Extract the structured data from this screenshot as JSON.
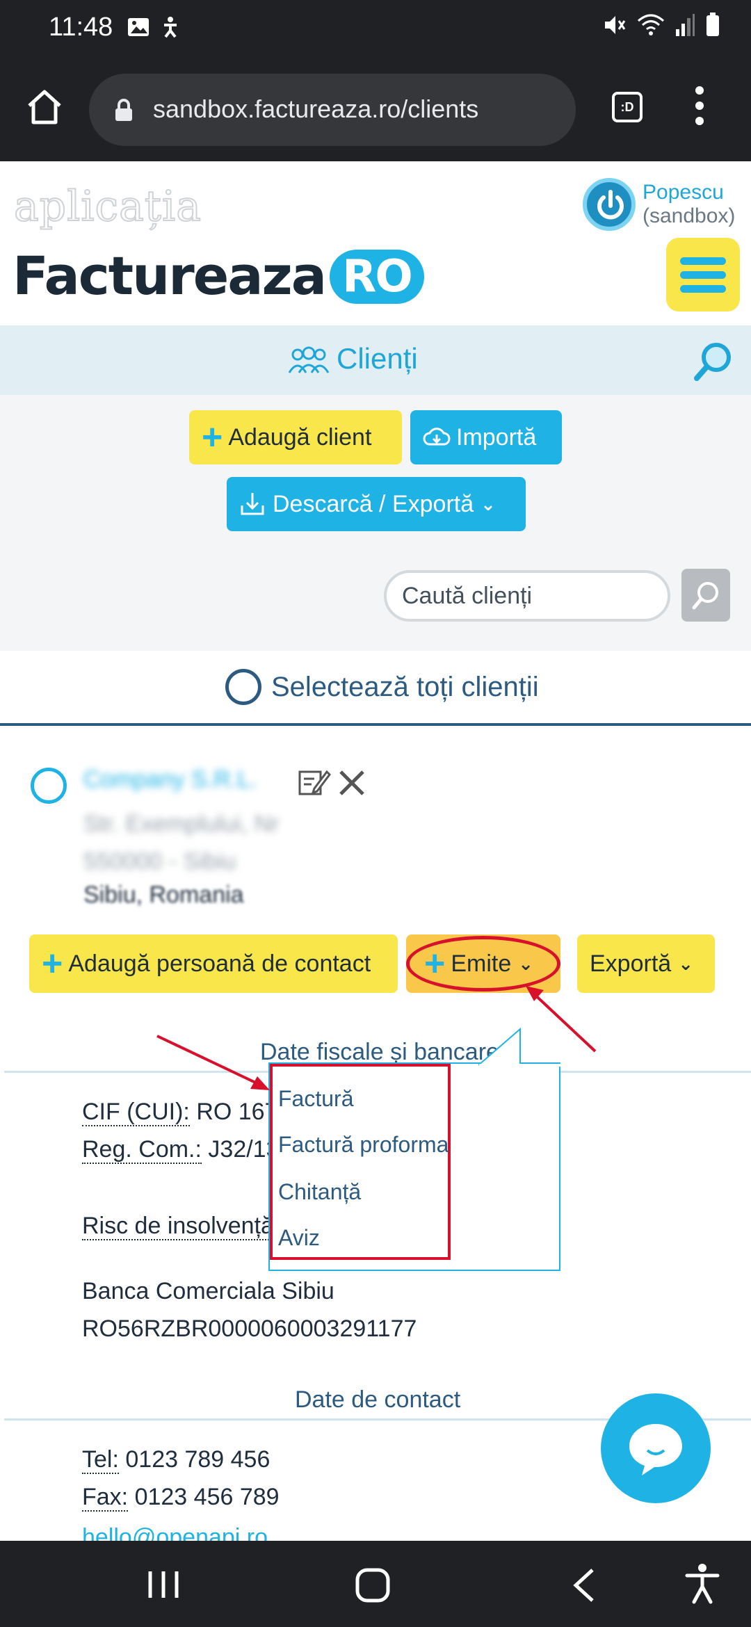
{
  "status_bar": {
    "time": "11:48"
  },
  "browser": {
    "url": "sandbox.factureaza.ro/clients",
    "tabs_badge": ":D"
  },
  "header": {
    "app_tagline": "aplicația",
    "logo_text": "Factureaza",
    "logo_badge": "RO",
    "user_name": "Popescu",
    "user_env": "(sandbox)"
  },
  "section": {
    "title": "Clienți"
  },
  "toolbar": {
    "add_client": "Adaugă client",
    "import": "Importă",
    "download_export": "Descarcă / Exportă",
    "search_placeholder": "Caută clienți"
  },
  "select_all_label": "Selectează toți clienții",
  "client": {
    "name": "Company S.R.L.",
    "street": "Str. Exemplului, Nr",
    "postal": "550000 - Sibiu",
    "city": "Sibiu, Romania",
    "actions": {
      "add_contact": "Adaugă persoană de contact",
      "emite": "Emite",
      "export": "Exportă"
    },
    "fiscal_header": "Date fiscale și bancare",
    "cif_label": "CIF (CUI):",
    "cif_value": "RO 1675",
    "reg_label": "Reg. Com.:",
    "reg_value": "J32/13",
    "insolvency_label": "Risc de insolvență",
    "bank_name": "Banca Comerciala Sibiu",
    "iban": "RO56RZBR0000060003291177",
    "contact_header": "Date de contact",
    "tel_label": "Tel:",
    "tel_value": "0123 789 456",
    "fax_label": "Fax:",
    "fax_value": "0123 456 789",
    "email": "hello@openapi.ro"
  },
  "emite_menu": [
    "Factură",
    "Factură proforma",
    "Chitanță",
    "Aviz"
  ],
  "colors": {
    "accent_blue": "#1fb3e5",
    "accent_yellow": "#f9e64a",
    "annotation_red": "#d8102b",
    "dark_blue": "#2c5a80"
  }
}
